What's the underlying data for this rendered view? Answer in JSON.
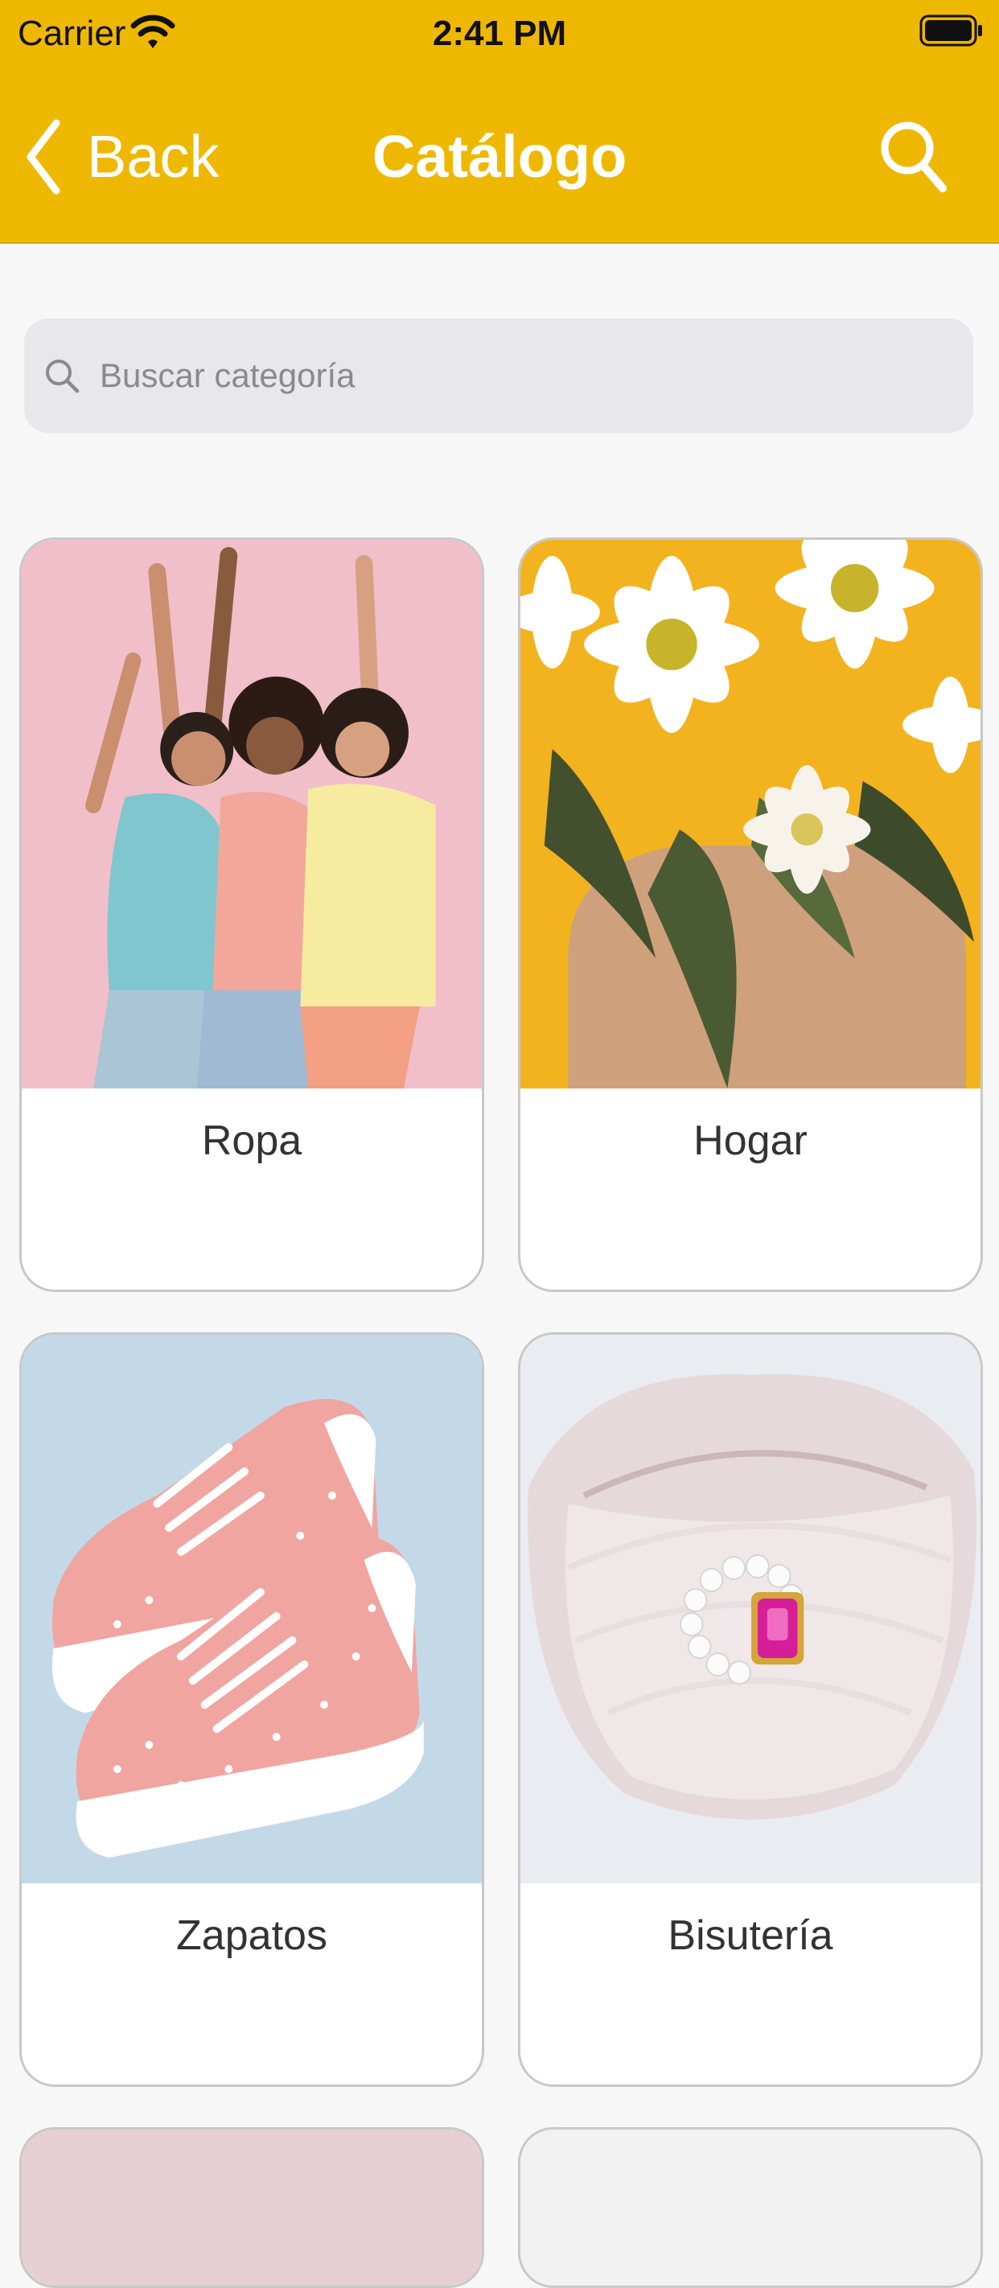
{
  "status_bar": {
    "carrier": "Carrier",
    "time": "2:41 PM"
  },
  "nav": {
    "back_label": "Back",
    "title": "Catálogo",
    "search_icon": "magnifier-icon"
  },
  "search": {
    "placeholder": "Buscar categoría",
    "value": ""
  },
  "categories": [
    {
      "label": "Ropa",
      "image": "women-dancing-photo"
    },
    {
      "label": "Hogar",
      "image": "daisies-vase-photo"
    },
    {
      "label": "Zapatos",
      "image": "pink-polka-sneakers-photo"
    },
    {
      "label": "Bisutería",
      "image": "pearl-ring-shell-photo"
    }
  ],
  "colors": {
    "nav_bar": "#efb800",
    "nav_text": "#ffffff",
    "background": "#f7f7f7",
    "search_field": "#e8e8ea",
    "card_border": "#c8c8c8"
  }
}
